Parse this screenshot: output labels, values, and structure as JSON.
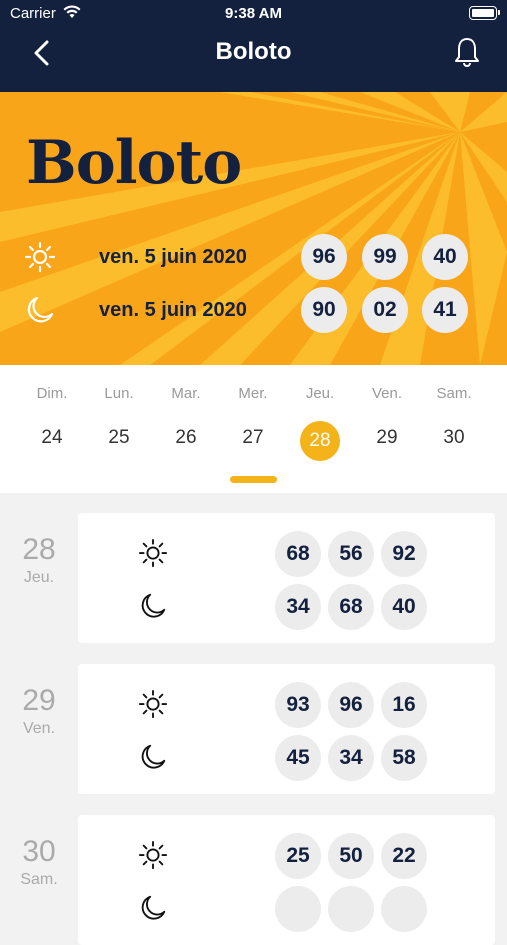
{
  "status_bar": {
    "carrier": "Carrier",
    "time": "9:38 AM"
  },
  "navbar": {
    "title": "Boloto"
  },
  "hero": {
    "logo": "Boloto",
    "draws": [
      {
        "icon": "sun-icon",
        "date": "ven. 5 juin 2020",
        "numbers": [
          "96",
          "99",
          "40"
        ]
      },
      {
        "icon": "moon-icon",
        "date": "ven. 5 juin 2020",
        "numbers": [
          "90",
          "02",
          "41"
        ]
      }
    ]
  },
  "week": {
    "days": [
      {
        "name": "Dim.",
        "num": "24"
      },
      {
        "name": "Lun.",
        "num": "25"
      },
      {
        "name": "Mar.",
        "num": "26"
      },
      {
        "name": "Mer.",
        "num": "27"
      },
      {
        "name": "Jeu.",
        "num": "28",
        "selected": true
      },
      {
        "name": "Ven.",
        "num": "29"
      },
      {
        "name": "Sam.",
        "num": "30"
      }
    ]
  },
  "results": [
    {
      "day": "28",
      "label": "Jeu.",
      "sun": [
        "68",
        "56",
        "92"
      ],
      "moon": [
        "34",
        "68",
        "40"
      ]
    },
    {
      "day": "29",
      "label": "Ven.",
      "sun": [
        "93",
        "96",
        "16"
      ],
      "moon": [
        "45",
        "34",
        "58"
      ]
    },
    {
      "day": "30",
      "label": "Sam.",
      "sun": [
        "25",
        "50",
        "22"
      ],
      "moon": []
    }
  ],
  "colors": {
    "navy": "#13213f",
    "accent": "#f5b31a",
    "ball": "#ececec"
  }
}
